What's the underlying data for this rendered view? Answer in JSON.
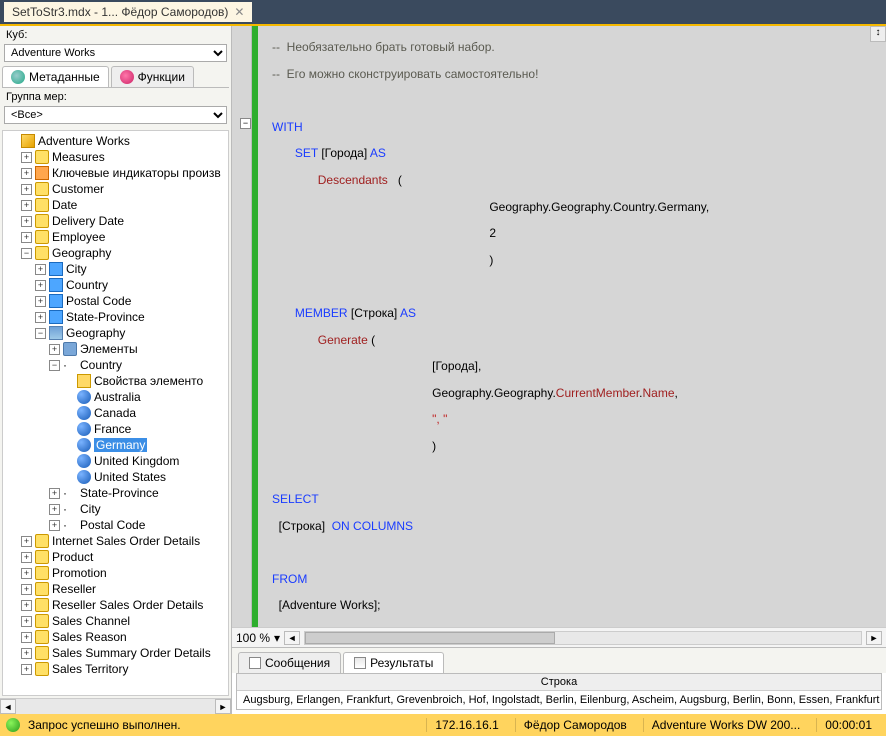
{
  "titlebar": {
    "tab": "SetToStr3.mdx - 1... Фёдор Самородов)"
  },
  "sidebar": {
    "cube_label": "Куб:",
    "cube_value": "Adventure Works",
    "tabs": {
      "metadata": "Метаданные",
      "functions": "Функции"
    },
    "group_label": "Группа мер:",
    "group_value": "<Все>",
    "tree": [
      {
        "lvl": 0,
        "exp": " ",
        "ico": "cube",
        "t": "Adventure Works"
      },
      {
        "lvl": 1,
        "exp": "+",
        "ico": "dim",
        "t": "Measures"
      },
      {
        "lvl": 1,
        "exp": "+",
        "ico": "key",
        "t": "Ключевые индикаторы произв"
      },
      {
        "lvl": 1,
        "exp": "+",
        "ico": "dim",
        "t": "Customer"
      },
      {
        "lvl": 1,
        "exp": "+",
        "ico": "dim",
        "t": "Date"
      },
      {
        "lvl": 1,
        "exp": "+",
        "ico": "dim",
        "t": "Delivery Date"
      },
      {
        "lvl": 1,
        "exp": "+",
        "ico": "dim",
        "t": "Employee"
      },
      {
        "lvl": 1,
        "exp": "−",
        "ico": "dim",
        "t": "Geography"
      },
      {
        "lvl": 2,
        "exp": "+",
        "ico": "attr",
        "t": "City"
      },
      {
        "lvl": 2,
        "exp": "+",
        "ico": "attr",
        "t": "Country"
      },
      {
        "lvl": 2,
        "exp": "+",
        "ico": "attr",
        "t": "Postal Code"
      },
      {
        "lvl": 2,
        "exp": "+",
        "ico": "attr",
        "t": "State-Province"
      },
      {
        "lvl": 2,
        "exp": "−",
        "ico": "hier",
        "t": "Geography"
      },
      {
        "lvl": 3,
        "exp": "+",
        "ico": "solids",
        "t": "Элементы"
      },
      {
        "lvl": 3,
        "exp": "−",
        "ico": "",
        "t": "Country"
      },
      {
        "lvl": 4,
        "exp": " ",
        "ico": "folder",
        "t": "Свойства элементо"
      },
      {
        "lvl": 4,
        "exp": " ",
        "ico": "ball",
        "t": "Australia"
      },
      {
        "lvl": 4,
        "exp": " ",
        "ico": "ball",
        "t": "Canada"
      },
      {
        "lvl": 4,
        "exp": " ",
        "ico": "ball",
        "t": "France"
      },
      {
        "lvl": 4,
        "exp": " ",
        "ico": "ball",
        "t": "Germany",
        "sel": true
      },
      {
        "lvl": 4,
        "exp": " ",
        "ico": "ball",
        "t": "United Kingdom"
      },
      {
        "lvl": 4,
        "exp": " ",
        "ico": "ball",
        "t": "United States"
      },
      {
        "lvl": 3,
        "exp": "+",
        "ico": "",
        "t": "State-Province"
      },
      {
        "lvl": 3,
        "exp": "+",
        "ico": "",
        "t": "City"
      },
      {
        "lvl": 3,
        "exp": "+",
        "ico": "",
        "t": "Postal Code"
      },
      {
        "lvl": 1,
        "exp": "+",
        "ico": "dim",
        "t": "Internet Sales Order Details"
      },
      {
        "lvl": 1,
        "exp": "+",
        "ico": "dim",
        "t": "Product"
      },
      {
        "lvl": 1,
        "exp": "+",
        "ico": "dim",
        "t": "Promotion"
      },
      {
        "lvl": 1,
        "exp": "+",
        "ico": "dim",
        "t": "Reseller"
      },
      {
        "lvl": 1,
        "exp": "+",
        "ico": "dim",
        "t": "Reseller Sales Order Details"
      },
      {
        "lvl": 1,
        "exp": "+",
        "ico": "dim",
        "t": "Sales Channel"
      },
      {
        "lvl": 1,
        "exp": "+",
        "ico": "dim",
        "t": "Sales Reason"
      },
      {
        "lvl": 1,
        "exp": "+",
        "ico": "dim",
        "t": "Sales Summary Order Details"
      },
      {
        "lvl": 1,
        "exp": "+",
        "ico": "dim",
        "t": "Sales Territory"
      }
    ]
  },
  "zoom": "100 %",
  "code": {
    "c1": "--  Необязательно брать готовый набор.",
    "c2": "--  Его можно сконструировать самостоятельно!",
    "with": "WITH",
    "set": "SET",
    "set_name": " [Города] ",
    "as": "AS",
    "desc": "Descendants",
    "lp": "   (",
    "arg1": "Geography.Geography.Country.Germany,",
    "arg2": "2",
    "rp": ")",
    "member": "MEMBER",
    "member_name": " [Строка] ",
    "gen": "Generate",
    "glp": " (",
    "g1": "[Города],",
    "g2a": "Geography.Geography.",
    "g2b": "CurrentMember",
    "g2c": ".",
    "g2d": "Name",
    "g2e": ",",
    "g3": "\", \"",
    "grp": ")",
    "select": "SELECT",
    "sel_body": "  [Строка]  ",
    "oncols": "ON COLUMNS",
    "from": "FROM",
    "from_body": "  [Adventure Works];"
  },
  "results": {
    "tabs": {
      "messages": "Сообщения",
      "results": "Результаты"
    },
    "header": "Строка",
    "row": " Augsburg, Erlangen, Frankfurt, Grevenbroich, Hof, Ingolstadt, Berlin, Eilenburg, Ascheim, Augsburg, Berlin, Bonn, Essen, Frankfurt ..."
  },
  "status": {
    "msg": "Запрос успешно выполнен.",
    "ip": "172.16.16.1",
    "user": "Фёдор Самородов",
    "db": "Adventure Works DW 200...",
    "time": "00:00:01"
  }
}
